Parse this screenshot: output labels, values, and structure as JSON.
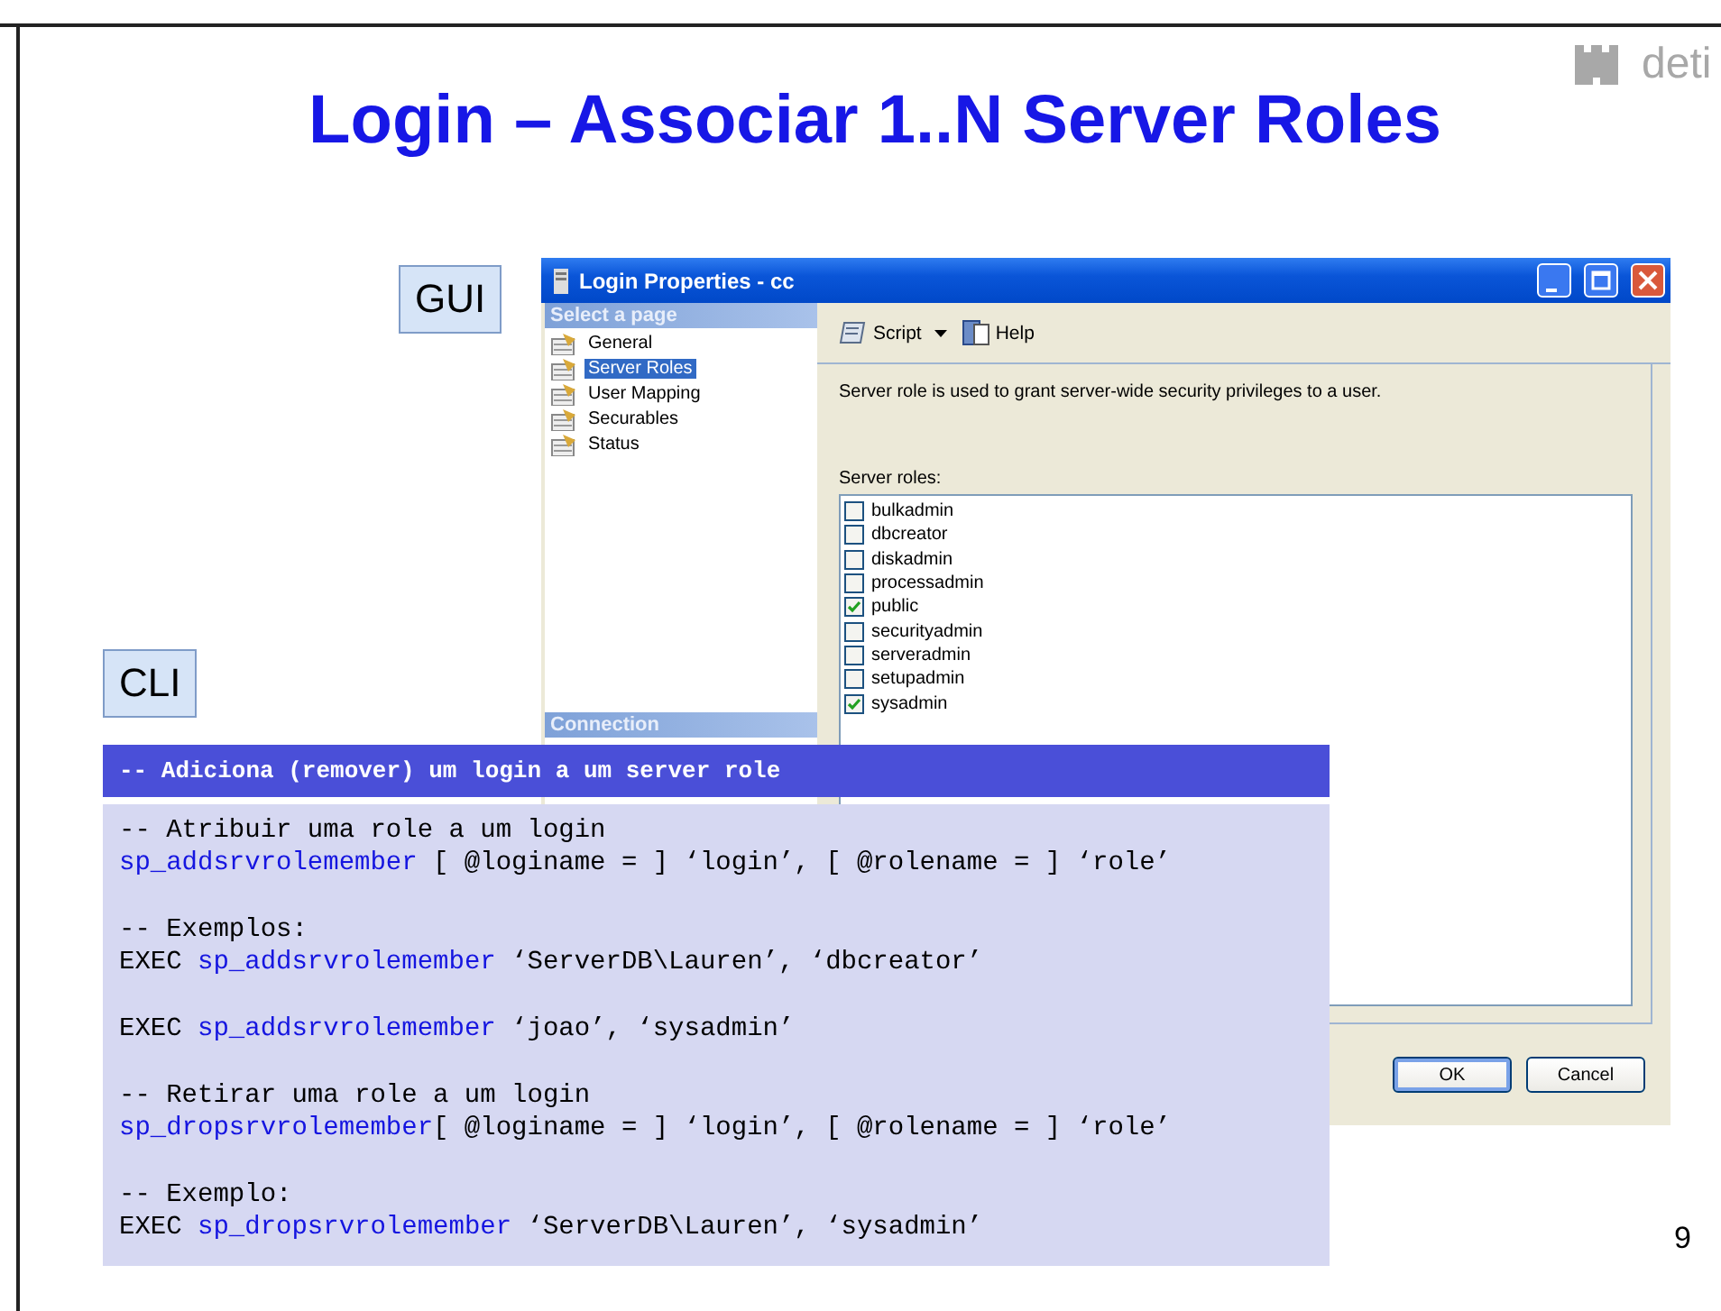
{
  "slide": {
    "title": "Login – Associar 1..N Server Roles",
    "logo_text": "deti",
    "gui_label": "GUI",
    "cli_label": "CLI",
    "page_number": "9"
  },
  "dialog": {
    "title": "Login Properties - cc",
    "select_header": "Select a page",
    "connection_header": "Connection",
    "pages": [
      {
        "label": "General",
        "selected": false
      },
      {
        "label": "Server Roles",
        "selected": true
      },
      {
        "label": "User Mapping",
        "selected": false
      },
      {
        "label": "Securables",
        "selected": false
      },
      {
        "label": "Status",
        "selected": false
      }
    ],
    "toolbar": [
      {
        "label": "Script",
        "kind": "dropdown"
      },
      {
        "label": "Help",
        "kind": "button"
      }
    ],
    "description": "Server role is used to grant server-wide security privileges to a user.",
    "roles_label": "Server roles:",
    "roles": [
      {
        "name": "bulkadmin",
        "checked": false
      },
      {
        "name": "dbcreator",
        "checked": false
      },
      {
        "name": "diskadmin",
        "checked": false
      },
      {
        "name": "processadmin",
        "checked": false
      },
      {
        "name": "public",
        "checked": true
      },
      {
        "name": "securityadmin",
        "checked": false
      },
      {
        "name": "serveradmin",
        "checked": false
      },
      {
        "name": "setupadmin",
        "checked": false
      },
      {
        "name": "sysadmin",
        "checked": true
      }
    ],
    "buttons": [
      {
        "label": "OK",
        "default": true
      },
      {
        "label": "Cancel",
        "default": false
      }
    ]
  },
  "code": {
    "header": "-- Adiciona (remover) um login a um server role",
    "blocks": [
      [
        [
          {
            "text": "-- Atribuir uma role a um login",
            "kind": "plain"
          }
        ],
        [
          {
            "text": "sp_addsrvrolemember",
            "kind": "proc"
          },
          {
            "text": " [ @loginame = ] ‘login’, [ @rolename = ] ‘role’",
            "kind": "plain"
          }
        ]
      ],
      [
        [
          {
            "text": "-- Exemplos:",
            "kind": "plain"
          }
        ],
        [
          {
            "text": "EXEC ",
            "kind": "plain"
          },
          {
            "text": "sp_addsrvrolemember",
            "kind": "proc"
          },
          {
            "text": " ‘ServerDB\\Lauren’, ‘dbcreator’",
            "kind": "plain"
          }
        ]
      ],
      [
        [
          {
            "text": "EXEC ",
            "kind": "plain"
          },
          {
            "text": "sp_addsrvrolemember",
            "kind": "proc"
          },
          {
            "text": " ‘joao’, ‘sysadmin’",
            "kind": "plain"
          }
        ]
      ],
      [
        [
          {
            "text": "-- Retirar uma role a um login",
            "kind": "plain"
          }
        ],
        [
          {
            "text": "sp_dropsrvrolemember",
            "kind": "proc"
          },
          {
            "text": "[ @loginame = ] ‘login’, [ @rolename = ] ‘role’",
            "kind": "plain"
          }
        ]
      ],
      [
        [
          {
            "text": "-- Exemplo:",
            "kind": "plain"
          }
        ],
        [
          {
            "text": "EXEC ",
            "kind": "plain"
          },
          {
            "text": "sp_dropsrvrolemember",
            "kind": "proc"
          },
          {
            "text": " ‘ServerDB\\Lauren’, ‘sysadmin’",
            "kind": "plain"
          }
        ]
      ]
    ]
  }
}
